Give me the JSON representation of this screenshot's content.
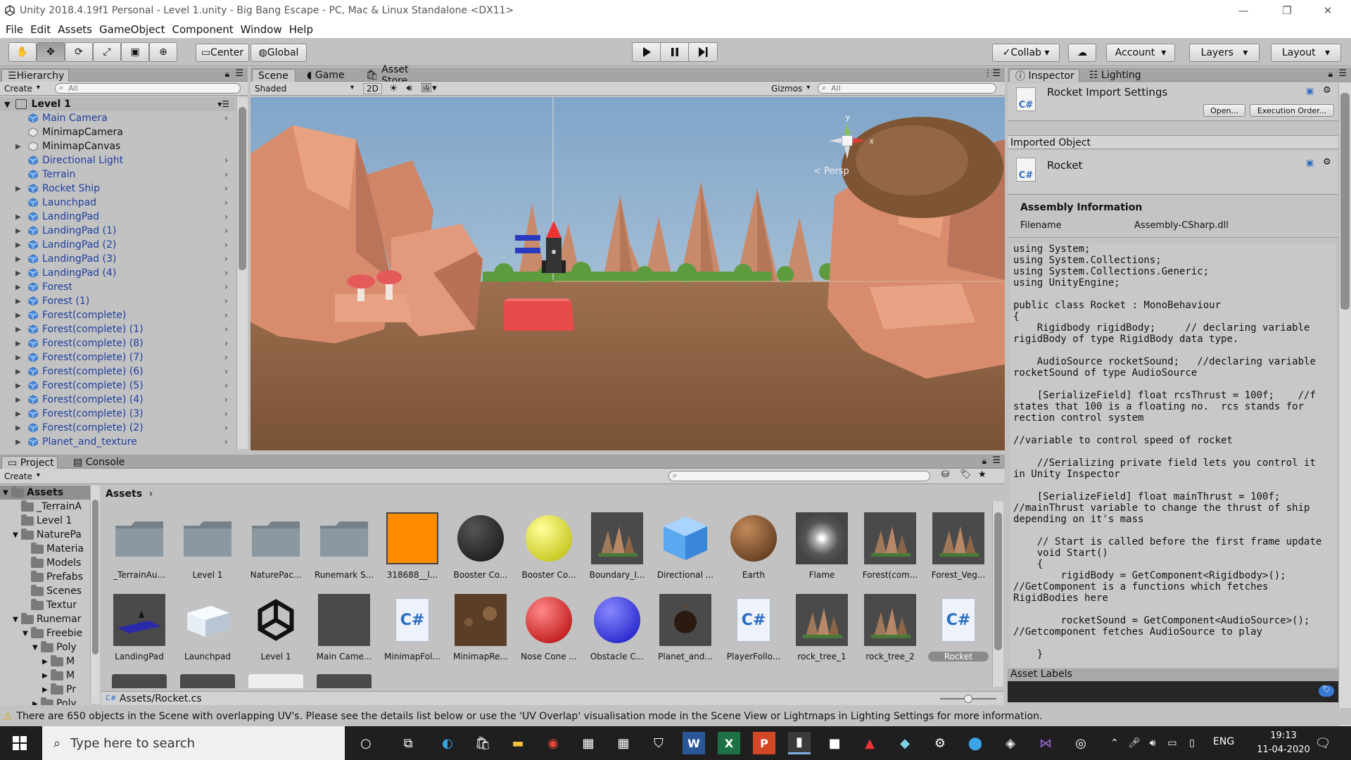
{
  "window": {
    "title": "Unity 2018.4.19f1 Personal - Level 1.unity - Big Bang Escape - PC, Mac & Linux Standalone <DX11>"
  },
  "menu": [
    "File",
    "Edit",
    "Assets",
    "GameObject",
    "Component",
    "Window",
    "Help"
  ],
  "toolbar": {
    "center": "Center",
    "global": "Global",
    "collab": "Collab",
    "account": "Account",
    "layers": "Layers",
    "layout": "Layout"
  },
  "hierarchy": {
    "tab": "Hierarchy",
    "create": "Create",
    "search_placeholder": "All",
    "scene": "Level 1",
    "items": [
      {
        "name": "Main Camera",
        "expand": false,
        "child": true
      },
      {
        "name": "MinimapCamera",
        "expand": false,
        "child": false
      },
      {
        "name": "MinimapCanvas",
        "expand": true,
        "child": false
      },
      {
        "name": "Directional Light",
        "expand": false,
        "child": true
      },
      {
        "name": "Terrain",
        "expand": false,
        "child": true
      },
      {
        "name": "Rocket Ship",
        "expand": true,
        "child": true
      },
      {
        "name": "Launchpad",
        "expand": false,
        "child": true
      },
      {
        "name": "LandingPad",
        "expand": true,
        "child": true
      },
      {
        "name": "LandingPad (1)",
        "expand": true,
        "child": true
      },
      {
        "name": "LandingPad (2)",
        "expand": true,
        "child": true
      },
      {
        "name": "LandingPad (3)",
        "expand": true,
        "child": true
      },
      {
        "name": "LandingPad (4)",
        "expand": true,
        "child": true
      },
      {
        "name": "Forest",
        "expand": true,
        "child": true
      },
      {
        "name": "Forest (1)",
        "expand": true,
        "child": true
      },
      {
        "name": "Forest(complete)",
        "expand": true,
        "child": true
      },
      {
        "name": "Forest(complete) (1)",
        "expand": true,
        "child": true
      },
      {
        "name": "Forest(complete) (8)",
        "expand": true,
        "child": true
      },
      {
        "name": "Forest(complete) (7)",
        "expand": true,
        "child": true
      },
      {
        "name": "Forest(complete) (6)",
        "expand": true,
        "child": true
      },
      {
        "name": "Forest(complete) (5)",
        "expand": true,
        "child": true
      },
      {
        "name": "Forest(complete) (4)",
        "expand": true,
        "child": true
      },
      {
        "name": "Forest(complete) (3)",
        "expand": true,
        "child": true
      },
      {
        "name": "Forest(complete) (2)",
        "expand": true,
        "child": true
      },
      {
        "name": "Planet_and_texture",
        "expand": true,
        "child": true
      }
    ]
  },
  "scene": {
    "tabs": [
      "Scene",
      "Game",
      "Asset Store"
    ],
    "shading": "Shaded",
    "mode2d": "2D",
    "gizmos": "Gizmos",
    "search_placeholder": "All",
    "persp": "Persp"
  },
  "inspector": {
    "tabs": [
      "Inspector",
      "Lighting"
    ],
    "title": "Rocket Import Settings",
    "open_btn": "Open...",
    "exec_btn": "Execution Order...",
    "imported_object": "Imported Object",
    "object_name": "Rocket",
    "assembly_header": "Assembly Information",
    "filename_label": "Filename",
    "filename_value": "Assembly-CSharp.dll",
    "code": "using System;\nusing System.Collections;\nusing System.Collections.Generic;\nusing UnityEngine;\n\npublic class Rocket : MonoBehaviour\n{\n    Rigidbody rigidBody;     // declaring variable rigidBody of type RigidBody data type.\n\n    AudioSource rocketSound;   //declaring variable rocketSound of type AudioSource\n\n    [SerializeField] float rcsThrust = 100f;    //f states that 100 is a floating no.  rcs stands for rection control system\n                                                                  //variable to control speed of rocket\n\n    //Serializing private field lets you control it in Unity Inspector\n\n    [SerializeField] float mainThrust = 100f;    //mainThrust variable to change the thrust of ship depending on it's mass\n\n    // Start is called before the first frame update\n    void Start()\n    {\n        rigidBody = GetComponent<Rigidbody>();\n//GetComponent is a functions which fetches RigidBodies here\n\n        rocketSound = GetComponent<AudioSource>();\n//Getcomponent fetches AudioSource to play\n\n    }\n\n    // Update is called once per frame\n    void Update()\n    {\n        Thrust();            // Function which handles thrusting of",
    "asset_labels": "Asset Labels"
  },
  "project": {
    "tabs": [
      "Project",
      "Console"
    ],
    "create": "Create",
    "breadcrumb": "Assets",
    "tree": [
      {
        "label": "Assets",
        "depth": 0,
        "expanded": true,
        "selected": true
      },
      {
        "label": "_TerrainA",
        "depth": 1
      },
      {
        "label": "Level 1",
        "depth": 1
      },
      {
        "label": "NaturePa",
        "depth": 1,
        "expanded": true
      },
      {
        "label": "Materia",
        "depth": 2
      },
      {
        "label": "Models",
        "depth": 2
      },
      {
        "label": "Prefabs",
        "depth": 2
      },
      {
        "label": "Scenes",
        "depth": 2
      },
      {
        "label": "Textur",
        "depth": 2
      },
      {
        "label": "Runemar",
        "depth": 1,
        "expanded": true
      },
      {
        "label": "Freebie",
        "depth": 2,
        "expanded": true
      },
      {
        "label": "Poly",
        "depth": 3,
        "expanded": true
      },
      {
        "label": "M",
        "depth": 4
      },
      {
        "label": "M",
        "depth": 4
      },
      {
        "label": "Pr",
        "depth": 4
      },
      {
        "label": "Poly",
        "depth": 3
      }
    ],
    "row1": [
      {
        "label": "_TerrainAu...",
        "kind": "folder"
      },
      {
        "label": "Level 1",
        "kind": "folder"
      },
      {
        "label": "NaturePac...",
        "kind": "folder"
      },
      {
        "label": "Runemark S...",
        "kind": "folder"
      },
      {
        "label": "318688__l...",
        "kind": "orange"
      },
      {
        "label": "Booster Co...",
        "kind": "black-sphere"
      },
      {
        "label": "Booster Co...",
        "kind": "yellow-sphere"
      },
      {
        "label": "Boundary_I...",
        "kind": "model"
      },
      {
        "label": "Directional ...",
        "kind": "cube"
      },
      {
        "label": "Earth",
        "kind": "brown-sphere"
      },
      {
        "label": "Flame",
        "kind": "flame"
      },
      {
        "label": "Forest(com...",
        "kind": "model"
      },
      {
        "label": "Forest_Veg...",
        "kind": "model"
      }
    ],
    "row2": [
      {
        "label": "LandingPad",
        "kind": "pad"
      },
      {
        "label": "Launchpad",
        "kind": "white-cube"
      },
      {
        "label": "Level 1",
        "kind": "unity"
      },
      {
        "label": "Main Came...",
        "kind": "gray"
      },
      {
        "label": "MinimapFol...",
        "kind": "cs"
      },
      {
        "label": "MinimapRe...",
        "kind": "minimap"
      },
      {
        "label": "Nose Cone ...",
        "kind": "red-sphere"
      },
      {
        "label": "Obstacle C...",
        "kind": "blue-sphere"
      },
      {
        "label": "Planet_and...",
        "kind": "planet"
      },
      {
        "label": "PlayerFollo...",
        "kind": "cs"
      },
      {
        "label": "rock_tree_1",
        "kind": "model"
      },
      {
        "label": "rock_tree_2",
        "kind": "model"
      },
      {
        "label": "Rocket",
        "kind": "cs",
        "selected": true
      }
    ],
    "path": "Assets/Rocket.cs"
  },
  "status": {
    "message": "There are 650 objects in the Scene with overlapping UV's. Please see the details list below or use the 'UV Overlap' visualisation mode in the Scene View or Lightmaps in Lighting Settings for more information."
  },
  "taskbar": {
    "search_placeholder": "Type here to search",
    "lang": "ENG",
    "time": "19:13",
    "date": "11-04-2020"
  }
}
